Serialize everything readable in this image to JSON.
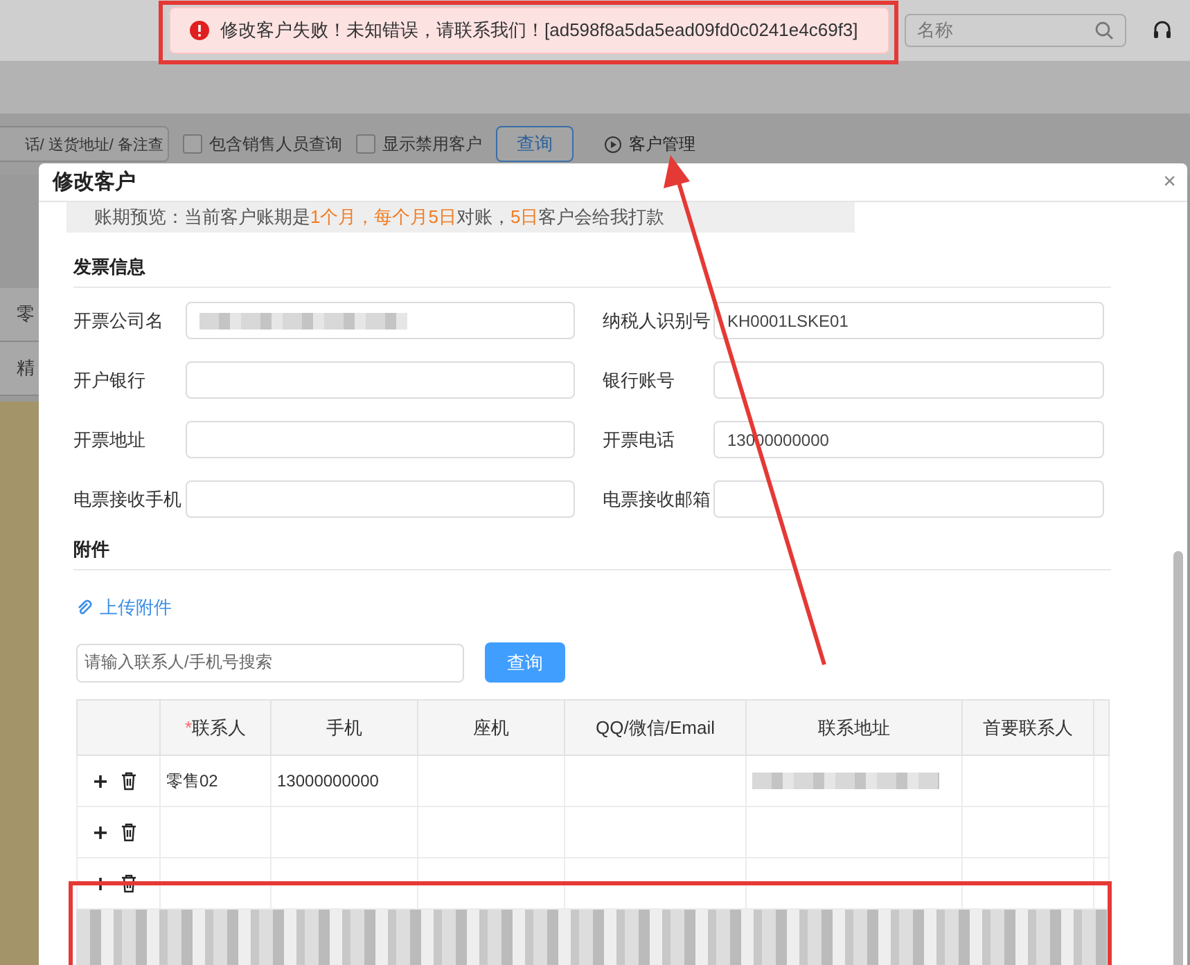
{
  "header": {
    "search_placeholder": "名称"
  },
  "toolbar": {
    "search_value": "话/ 送货地址/ 备注查",
    "checkboxes": [
      {
        "label": "包含销售人员查询",
        "checked": false
      },
      {
        "label": "显示禁用客户",
        "checked": false
      }
    ],
    "query_button": "查询",
    "link": "客户管理"
  },
  "background_cells": [
    "零",
    "精"
  ],
  "toast": {
    "message": "修改客户失败！未知错误，请联系我们！[ad598f8a5da5ead09fd0c0241e4c69f3]"
  },
  "dialog": {
    "title": "修改客户",
    "close_symbol": "×",
    "notice": [
      {
        "text": "账期预览：当前客户账期是",
        "highlight": false
      },
      {
        "text": "1个月，每个月5日",
        "highlight": true
      },
      {
        "text": "对账，",
        "highlight": false
      },
      {
        "text": "5日",
        "highlight": true
      },
      {
        "text": "客户会给我打款",
        "highlight": false
      }
    ],
    "invoice": {
      "title": "发票信息",
      "fields": [
        {
          "label": "开票公司名",
          "redacted": true
        },
        {
          "label": "纳税人识别号",
          "value": "KH0001LSKE01",
          "redacted": false
        },
        {
          "label": "开户银行",
          "redacted": false
        },
        {
          "label": "银行账号",
          "redacted": false
        },
        {
          "label": "开票地址",
          "redacted": false
        },
        {
          "label": "开票电话",
          "value": "13000000000",
          "redacted": false
        },
        {
          "label": "电票接收手机",
          "redacted": false
        },
        {
          "label": "电票接收邮箱",
          "redacted": false
        }
      ]
    },
    "attachments": {
      "title": "附件",
      "upload_link": "上传附件",
      "search_placeholder": "请输入联系人/手机号搜索",
      "search_button": "查询"
    },
    "contacts": {
      "columns": [
        {
          "label": "联系人",
          "required_mark": "*"
        },
        {
          "label": "手机"
        },
        {
          "label": "座机"
        },
        {
          "label": "QQ/微信/Email"
        },
        {
          "label": "联系地址"
        },
        {
          "label": "首要联系人"
        }
      ],
      "rows": [
        {
          "contact": "零售02",
          "mobile": "13000000000",
          "address_redacted": true
        },
        {
          "address_redacted": false
        },
        {
          "address_redacted": false
        }
      ]
    },
    "remarks": {
      "redacted": true
    }
  }
}
